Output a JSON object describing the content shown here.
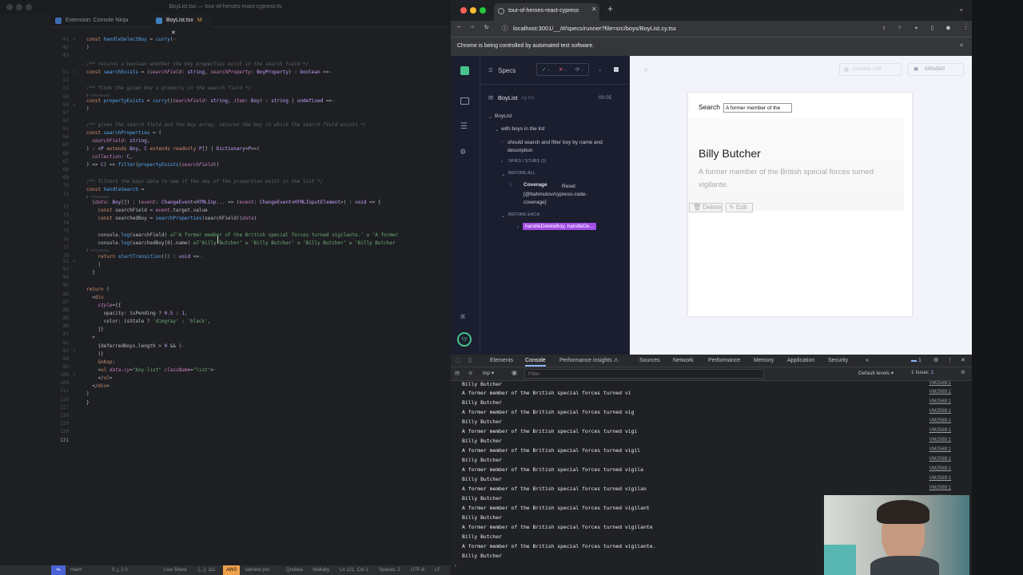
{
  "vscode": {
    "window_title": "BoyList.tsx — tour-of-heroes-react-cypress-ts",
    "tabs": [
      {
        "label": "Extension: Console Ninja"
      },
      {
        "label": "BoyList.tsx",
        "badge": "M"
      }
    ],
    "line_numbers": [
      "41",
      "42",
      "43",
      "51",
      "52",
      "53",
      "54",
      "56",
      "57",
      "62",
      "63",
      "64",
      "65",
      "66",
      "67",
      "68",
      "69",
      "70",
      "71",
      "72",
      "73",
      "74",
      "75",
      "76",
      "77",
      "78",
      "82",
      "83",
      "84",
      "85",
      "86",
      "87",
      "88",
      "89",
      "90",
      "91",
      "92",
      "93",
      "94",
      "95",
      "108",
      "109",
      "115",
      "116",
      "117",
      "118",
      "119",
      "120",
      "121"
    ],
    "refs": "0 references",
    "status": {
      "branch": "main*",
      "sync": "0 △ 1 0",
      "live_share": "Live Share",
      "braces": "{...}: 111",
      "aws": "AWS",
      "tabnine": "tabnine pro",
      "quokka": "Quokka",
      "wallaby": "Wallaby",
      "position": "Ln 121, Col 1",
      "spaces": "Spaces: 2",
      "encoding": "UTF-8",
      "eol": "LF"
    }
  },
  "chrome": {
    "tab_title": "tour-of-heroes-react-cypress",
    "url": "localhost:3001/__/#/specs/runner?file=src/boys/BoyList.cy.tsx",
    "automation_banner": "Chrome is being controlled by automated test software."
  },
  "cypress": {
    "specs_label": "Specs",
    "spec_file": "BoyList",
    "spec_ext": ".cy.tsx",
    "duration": "00:05",
    "suite": "BoyList",
    "context": "with boys in the list",
    "test": "should search and filter boy by name and description",
    "spies": "SPIES / STUBS (1)",
    "before_all": "BEFORE ALL",
    "cmd_num": "1",
    "cmd_name": "Coverage",
    "cmd_msg": "Reset [@bahmutov/cypress-code-coverage]",
    "before_each": "BEFORE EACH",
    "alias": "handleDeleteBoy, handleDe...",
    "browser": "Chrome 108",
    "viewport": "500x500"
  },
  "app": {
    "search_label": "Search",
    "search_value": "A former member of the",
    "boy_name": "Billy Butcher",
    "boy_desc": "A former member of the British special forces turned vigilante.",
    "delete_label": "Delete",
    "edit_label": "Edit"
  },
  "devtools": {
    "tabs": [
      "Elements",
      "Console",
      "Performance insights ⚠",
      "Sources",
      "Network",
      "Performance",
      "Memory",
      "Application",
      "Security",
      "»"
    ],
    "issues_badge": "1",
    "context": "top",
    "filter_placeholder": "Filter",
    "levels": "Default levels ▾",
    "issue_label": "1 Issue:",
    "issue_count": "1",
    "source": "VM2569:1",
    "logs": [
      "Billy Butcher",
      "A former member of the British special forces turned vi",
      "Billy Butcher",
      "A former member of the British special forces turned vig",
      "Billy Butcher",
      "A former member of the British special forces turned vigi",
      "Billy Butcher",
      "A former member of the British special forces turned vigil",
      "Billy Butcher",
      "A former member of the British special forces turned vigila",
      "Billy Butcher",
      "A former member of the British special forces turned vigilan",
      "Billy Butcher",
      "A former member of the British special forces turned vigilant",
      "Billy Butcher",
      "A former member of the British special forces turned vigilante",
      "Billy Butcher",
      "A former member of the British special forces turned vigilante.",
      "Billy Butcher"
    ]
  },
  "colors": {
    "accent": "#4956e3",
    "alias_bg": "#a24de6",
    "aws": "#f0a04b"
  },
  "icons": [
    "search-icon",
    "git-branch-icon",
    "gear-icon",
    "cypress-logo-icon",
    "keyboard-icon",
    "debug-icon",
    "eye-icon",
    "console-clear-icon"
  ]
}
